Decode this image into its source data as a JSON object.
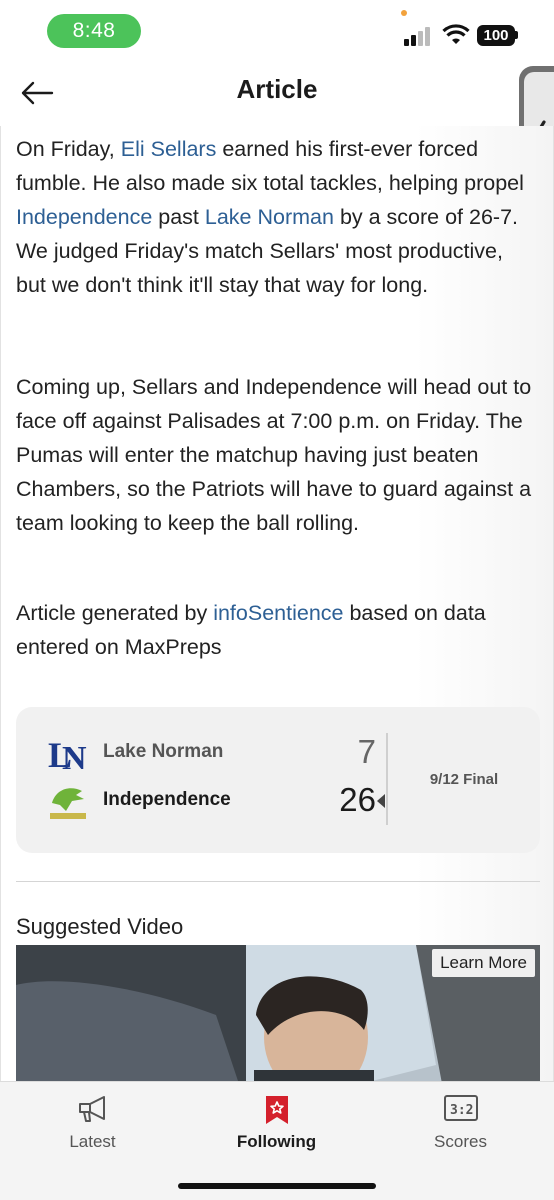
{
  "status_bar": {
    "time": "8:48",
    "battery": "100"
  },
  "header": {
    "title": "Article",
    "back_icon": "arrow-left-icon"
  },
  "side_handle": {
    "icon": "chevron-left-icon"
  },
  "article": {
    "p1": {
      "t1": "On Friday, ",
      "l1": "Eli Sellars",
      "t2": " earned his first-ever forced fumble. He also made six total tackles, helping propel ",
      "l2": "Independence",
      "t3": " past ",
      "l3": "Lake Norman",
      "t4": " by a score of 26-7. We judged Friday's match Sellars' most productive, but we don't think it'll stay that way for long."
    },
    "p2": "Coming up, Sellars and Independence will head out to face off against Palisades at 7:00 p.m. on Friday. The Pumas will enter the matchup having just beaten Chambers, so the Patriots will have to guard against a team looking to keep the ball rolling.",
    "p3": {
      "t1": "Article generated by ",
      "l1": "infoSentience",
      "t2": " based on data entered on MaxPreps"
    }
  },
  "score_card": {
    "teams": [
      {
        "name": "Lake Norman",
        "score": "7",
        "logo_text": "LN"
      },
      {
        "name": "Independence",
        "score": "26",
        "logo_text": ""
      }
    ],
    "status": "9/12 Final"
  },
  "suggested": {
    "heading": "Suggested Video",
    "learn_more": "Learn More"
  },
  "tabs": [
    {
      "label": "Latest",
      "icon": "megaphone-icon"
    },
    {
      "label": "Following",
      "icon": "bookmark-star-icon"
    },
    {
      "label": "Scores",
      "icon": "scoreboard-icon"
    }
  ],
  "colors": {
    "time_pill": "#4cc35a",
    "link": "#2d5f94",
    "active_tab": "#d4202c"
  }
}
